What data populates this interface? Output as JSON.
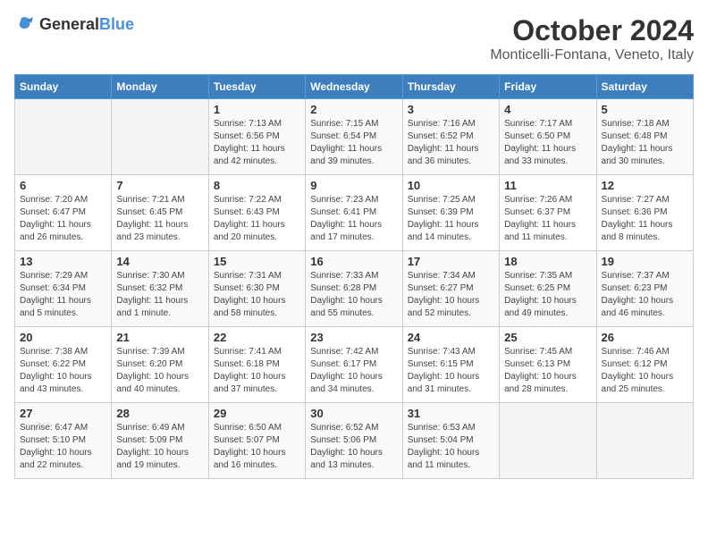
{
  "header": {
    "logo_general": "General",
    "logo_blue": "Blue",
    "month": "October 2024",
    "location": "Monticelli-Fontana, Veneto, Italy"
  },
  "weekdays": [
    "Sunday",
    "Monday",
    "Tuesday",
    "Wednesday",
    "Thursday",
    "Friday",
    "Saturday"
  ],
  "weeks": [
    [
      {
        "day": "",
        "info": ""
      },
      {
        "day": "",
        "info": ""
      },
      {
        "day": "1",
        "info": "Sunrise: 7:13 AM\nSunset: 6:56 PM\nDaylight: 11 hours and 42 minutes."
      },
      {
        "day": "2",
        "info": "Sunrise: 7:15 AM\nSunset: 6:54 PM\nDaylight: 11 hours and 39 minutes."
      },
      {
        "day": "3",
        "info": "Sunrise: 7:16 AM\nSunset: 6:52 PM\nDaylight: 11 hours and 36 minutes."
      },
      {
        "day": "4",
        "info": "Sunrise: 7:17 AM\nSunset: 6:50 PM\nDaylight: 11 hours and 33 minutes."
      },
      {
        "day": "5",
        "info": "Sunrise: 7:18 AM\nSunset: 6:48 PM\nDaylight: 11 hours and 30 minutes."
      }
    ],
    [
      {
        "day": "6",
        "info": "Sunrise: 7:20 AM\nSunset: 6:47 PM\nDaylight: 11 hours and 26 minutes."
      },
      {
        "day": "7",
        "info": "Sunrise: 7:21 AM\nSunset: 6:45 PM\nDaylight: 11 hours and 23 minutes."
      },
      {
        "day": "8",
        "info": "Sunrise: 7:22 AM\nSunset: 6:43 PM\nDaylight: 11 hours and 20 minutes."
      },
      {
        "day": "9",
        "info": "Sunrise: 7:23 AM\nSunset: 6:41 PM\nDaylight: 11 hours and 17 minutes."
      },
      {
        "day": "10",
        "info": "Sunrise: 7:25 AM\nSunset: 6:39 PM\nDaylight: 11 hours and 14 minutes."
      },
      {
        "day": "11",
        "info": "Sunrise: 7:26 AM\nSunset: 6:37 PM\nDaylight: 11 hours and 11 minutes."
      },
      {
        "day": "12",
        "info": "Sunrise: 7:27 AM\nSunset: 6:36 PM\nDaylight: 11 hours and 8 minutes."
      }
    ],
    [
      {
        "day": "13",
        "info": "Sunrise: 7:29 AM\nSunset: 6:34 PM\nDaylight: 11 hours and 5 minutes."
      },
      {
        "day": "14",
        "info": "Sunrise: 7:30 AM\nSunset: 6:32 PM\nDaylight: 11 hours and 1 minute."
      },
      {
        "day": "15",
        "info": "Sunrise: 7:31 AM\nSunset: 6:30 PM\nDaylight: 10 hours and 58 minutes."
      },
      {
        "day": "16",
        "info": "Sunrise: 7:33 AM\nSunset: 6:28 PM\nDaylight: 10 hours and 55 minutes."
      },
      {
        "day": "17",
        "info": "Sunrise: 7:34 AM\nSunset: 6:27 PM\nDaylight: 10 hours and 52 minutes."
      },
      {
        "day": "18",
        "info": "Sunrise: 7:35 AM\nSunset: 6:25 PM\nDaylight: 10 hours and 49 minutes."
      },
      {
        "day": "19",
        "info": "Sunrise: 7:37 AM\nSunset: 6:23 PM\nDaylight: 10 hours and 46 minutes."
      }
    ],
    [
      {
        "day": "20",
        "info": "Sunrise: 7:38 AM\nSunset: 6:22 PM\nDaylight: 10 hours and 43 minutes."
      },
      {
        "day": "21",
        "info": "Sunrise: 7:39 AM\nSunset: 6:20 PM\nDaylight: 10 hours and 40 minutes."
      },
      {
        "day": "22",
        "info": "Sunrise: 7:41 AM\nSunset: 6:18 PM\nDaylight: 10 hours and 37 minutes."
      },
      {
        "day": "23",
        "info": "Sunrise: 7:42 AM\nSunset: 6:17 PM\nDaylight: 10 hours and 34 minutes."
      },
      {
        "day": "24",
        "info": "Sunrise: 7:43 AM\nSunset: 6:15 PM\nDaylight: 10 hours and 31 minutes."
      },
      {
        "day": "25",
        "info": "Sunrise: 7:45 AM\nSunset: 6:13 PM\nDaylight: 10 hours and 28 minutes."
      },
      {
        "day": "26",
        "info": "Sunrise: 7:46 AM\nSunset: 6:12 PM\nDaylight: 10 hours and 25 minutes."
      }
    ],
    [
      {
        "day": "27",
        "info": "Sunrise: 6:47 AM\nSunset: 5:10 PM\nDaylight: 10 hours and 22 minutes."
      },
      {
        "day": "28",
        "info": "Sunrise: 6:49 AM\nSunset: 5:09 PM\nDaylight: 10 hours and 19 minutes."
      },
      {
        "day": "29",
        "info": "Sunrise: 6:50 AM\nSunset: 5:07 PM\nDaylight: 10 hours and 16 minutes."
      },
      {
        "day": "30",
        "info": "Sunrise: 6:52 AM\nSunset: 5:06 PM\nDaylight: 10 hours and 13 minutes."
      },
      {
        "day": "31",
        "info": "Sunrise: 6:53 AM\nSunset: 5:04 PM\nDaylight: 10 hours and 11 minutes."
      },
      {
        "day": "",
        "info": ""
      },
      {
        "day": "",
        "info": ""
      }
    ]
  ]
}
